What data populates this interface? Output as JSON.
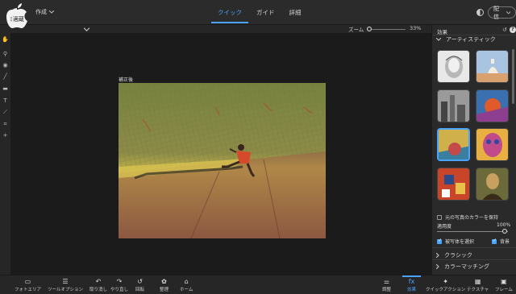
{
  "topbar": {
    "create_label": "作成",
    "modes": [
      "クイック",
      "ガイド",
      "詳細"
    ],
    "share_label": "配信"
  },
  "options": {
    "zoom_label": "ズーム",
    "zoom_value": "33%",
    "zoom_level": 0.33
  },
  "canvas": {
    "label": "補正後"
  },
  "panel": {
    "title": "効果",
    "section_artistic": "アーティスティック",
    "keep_color_label": "元の写真のカラーを保持",
    "amount_label": "適用度",
    "amount_value": "100%",
    "amount_level": 1.0,
    "subject_label": "被写体を選択",
    "background_label": "背景",
    "section_classic": "クラシック",
    "section_color_match": "カラーマッチング"
  },
  "bottom": {
    "photo_area": "フォトエリア",
    "tool_options": "ツールオプション",
    "undo": "取り消し",
    "redo": "やり直し",
    "rotate": "回転",
    "organize": "整理",
    "home": "ホーム",
    "adjust": "調整",
    "effects": "効果",
    "quick_actions": "クイックアクション",
    "textures": "テクスチャ",
    "frames": "フレーム"
  },
  "colors": {
    "accent": "#4aa3ff",
    "background": "#1e1e1e",
    "panel": "#2a2a2a"
  }
}
